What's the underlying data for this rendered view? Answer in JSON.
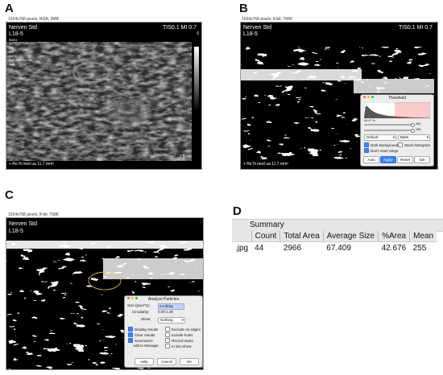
{
  "panels": {
    "A": {
      "letter": "A",
      "info": "1024x768 pixels; RGB; 3MB",
      "overlay": {
        "title": "Nerven Std",
        "probe": "L18-5",
        "ti_mi": "TIS0.1   MI 0.7",
        "side_lines": [
          "9MHz",
          "2D",
          "G8",
          "DR",
          "Gn",
          "Opt. Gerätch 55",
          "Aufl"
        ],
        "scale_top": "0",
        "scale_bottom": "2.5cm",
        "measure": "+ Re N med ua  11.7 mm²"
      }
    },
    "B": {
      "letter": "B",
      "info": "1024x768 pixels; 8-bit; 768K",
      "overlay": {
        "title": "Nerven Std",
        "probe": "L18-5",
        "ti_mi": "TIS0.1   MI 0.7",
        "measure": "+ Re N med ua  11.7 mm²"
      },
      "threshold_dialog": {
        "title": "Threshold",
        "percent": "44.47 %",
        "slider_values": [
          "255",
          "255"
        ],
        "method": "Default",
        "mode": "B&W",
        "checkboxes": [
          {
            "label": "Dark background",
            "checked": true
          },
          {
            "label": "Stack histogram",
            "checked": false
          },
          {
            "label": "Don't reset range",
            "checked": true
          }
        ],
        "buttons": [
          "Auto",
          "Apply",
          "Reset",
          "Set"
        ]
      }
    },
    "C": {
      "letter": "C",
      "info": "1024x768 pixels; 8-bit; 768K",
      "overlay": {
        "title": "Nerven Std",
        "probe": "L18-5"
      },
      "analyze_dialog": {
        "title": "Analyze Particles",
        "size_label": "Size (pixel^2):",
        "size_value": "0-Infinity",
        "circ_label": "Circularity:",
        "circ_value": "0.00-1.00",
        "show_label": "Show:",
        "show_value": "Nothing",
        "checkboxes": [
          {
            "label": "Display results",
            "checked": true
          },
          {
            "label": "Exclude on edges",
            "checked": false
          },
          {
            "label": "Clear results",
            "checked": true
          },
          {
            "label": "Include holes",
            "checked": false
          },
          {
            "label": "Summarize",
            "checked": true
          },
          {
            "label": "Record starts",
            "checked": false
          },
          {
            "label": "Add to Manager",
            "checked": false
          },
          {
            "label": "In situ Show",
            "checked": false
          }
        ],
        "buttons": [
          "Help",
          "Cancel",
          "OK"
        ]
      }
    },
    "D": {
      "letter": "D",
      "summary": {
        "title": "Summary",
        "columns": [
          "",
          "Count",
          "Total Area",
          "Average Size",
          "%Area",
          "Mean"
        ],
        "row": [
          ".jpg",
          "44",
          "2966",
          "67.409",
          "42.676",
          "255"
        ]
      }
    }
  }
}
